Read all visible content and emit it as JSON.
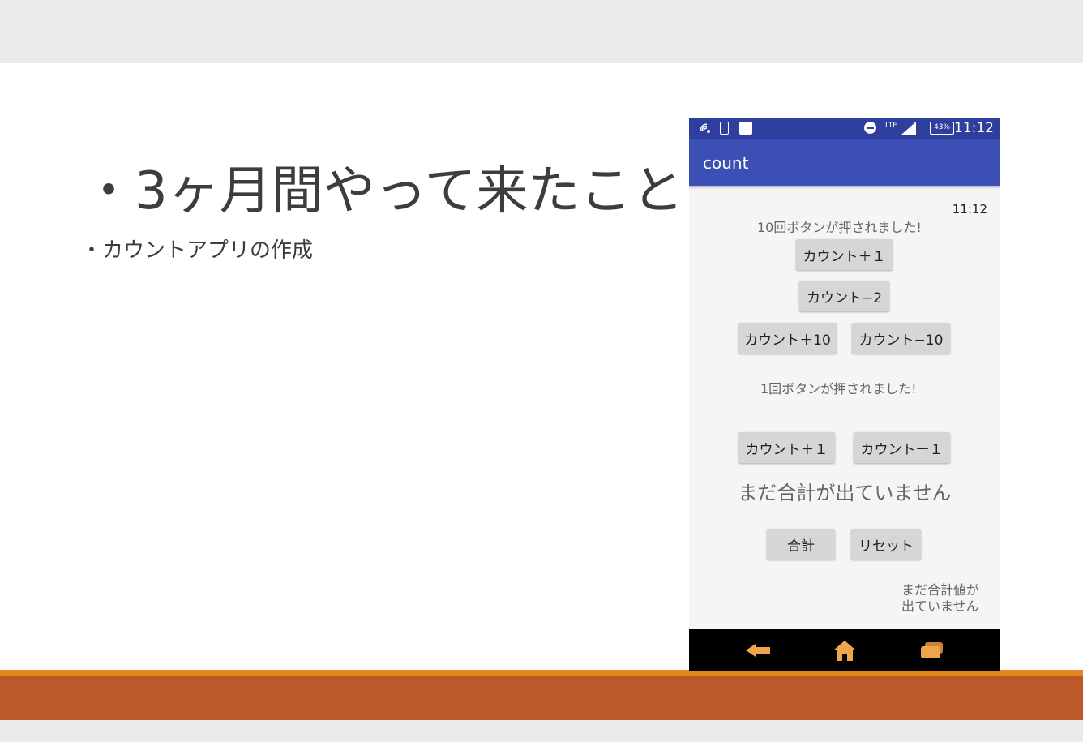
{
  "slide": {
    "title": "・3ヶ月間やって来たこと",
    "bullet": "・カウントアプリの作成"
  },
  "phone": {
    "status_bar": {
      "lte_label": "LTE",
      "battery": "43%",
      "time": "11:12",
      "icons": [
        "wifi-calling-icon",
        "battery-charging-icon",
        "notification-icon",
        "do-not-disturb-icon",
        "lte-icon",
        "signal-icon",
        "battery-icon"
      ]
    },
    "app_bar": {
      "title": "count"
    },
    "content": {
      "clock": "11:12",
      "message_1": "10回ボタンが押されました!",
      "btn_plus1_a": "カウント＋１",
      "btn_minus2": "カウント−2",
      "btn_plus10": "カウント＋10",
      "btn_minus10": "カウント−10",
      "message_2": "1回ボタンが押されました!",
      "btn_plus1_b": "カウント＋１",
      "btn_minus1": "カウントー１",
      "total_message": "まだ合計が出ていません",
      "btn_total": "合計",
      "btn_reset": "リセット",
      "corner_line_1": "まだ合計値が",
      "corner_line_2": "出ていません"
    },
    "nav_bar": {
      "icons": [
        "back-icon",
        "home-icon",
        "recent-apps-icon"
      ],
      "icon_color": "#f0a54a"
    }
  },
  "colors": {
    "accent_orange": "#e3871d",
    "accent_rust": "#bc592b",
    "app_bar": "#3b4fb4",
    "status_bar": "#2f3f9e"
  }
}
